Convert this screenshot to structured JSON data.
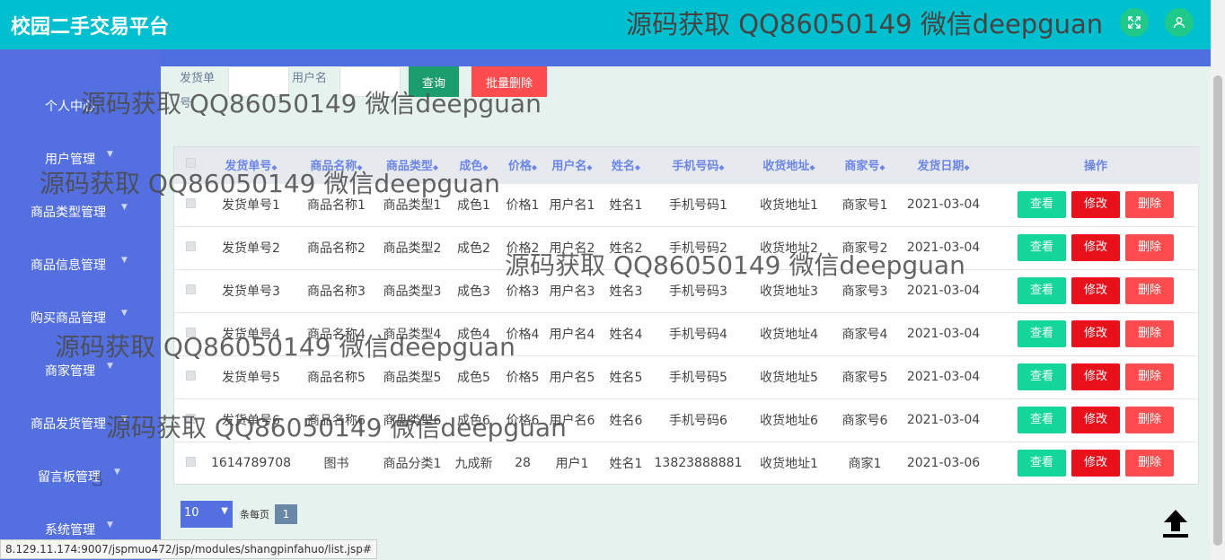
{
  "header": {
    "title": "校园二手交易平台",
    "watermark": "源码获取 QQ86050149 微信deepguan",
    "fullscreen_icon": "expand-icon",
    "user_icon": "user-icon"
  },
  "sidebar": {
    "items": [
      {
        "label": "个人中心"
      },
      {
        "label": "用户管理"
      },
      {
        "label": "商品类型管理"
      },
      {
        "label": "商品信息管理"
      },
      {
        "label": "购买商品管理"
      },
      {
        "label": "商家管理"
      },
      {
        "label": "商品发货管理"
      },
      {
        "label": "留言板管理"
      },
      {
        "label": "系统管理"
      }
    ]
  },
  "search": {
    "label1": "发货单号",
    "label2": "用户名",
    "query_label": "查询",
    "batch_delete_label": "批量删除"
  },
  "table": {
    "headers": [
      "发货单号",
      "商品名称",
      "商品类型",
      "成色",
      "价格",
      "用户名",
      "姓名",
      "手机号码",
      "收货地址",
      "商家号",
      "发货日期",
      "操作"
    ],
    "rows": [
      [
        "发货单号1",
        "商品名称1",
        "商品类型1",
        "成色1",
        "价格1",
        "用户名1",
        "姓名1",
        "手机号码1",
        "收货地址1",
        "商家号1",
        "2021-03-04"
      ],
      [
        "发货单号2",
        "商品名称2",
        "商品类型2",
        "成色2",
        "价格2",
        "用户名2",
        "姓名2",
        "手机号码2",
        "收货地址2",
        "商家号2",
        "2021-03-04"
      ],
      [
        "发货单号3",
        "商品名称3",
        "商品类型3",
        "成色3",
        "价格3",
        "用户名3",
        "姓名3",
        "手机号码3",
        "收货地址3",
        "商家号3",
        "2021-03-04"
      ],
      [
        "发货单号4",
        "商品名称4",
        "商品类型4",
        "成色4",
        "价格4",
        "用户名4",
        "姓名4",
        "手机号码4",
        "收货地址4",
        "商家号4",
        "2021-03-04"
      ],
      [
        "发货单号5",
        "商品名称5",
        "商品类型5",
        "成色5",
        "价格5",
        "用户名5",
        "姓名5",
        "手机号码5",
        "收货地址5",
        "商家号5",
        "2021-03-04"
      ],
      [
        "发货单号6",
        "商品名称6",
        "商品类型6",
        "成色6",
        "价格6",
        "用户名6",
        "姓名6",
        "手机号码6",
        "收货地址6",
        "商家号6",
        "2021-03-04"
      ],
      [
        "1614789708",
        "图书",
        "商品分类1",
        "九成新",
        "28",
        "用户1",
        "姓名1",
        "13823888881",
        "收货地址1",
        "商家1",
        "2021-03-06"
      ]
    ],
    "action_view": "查看",
    "action_edit": "修改",
    "action_delete": "删除"
  },
  "pager": {
    "page_size": "10",
    "per_page_label": "条每页",
    "current_page": "1"
  },
  "status_url": "8.129.11.174:9007/jspmuo472/jsp/modules/shangpinfahuo/list.jsp#",
  "colors": {
    "header_bg": "#00c0d0",
    "sidebar_bg": "#5470e0",
    "view_btn": "#14d69a",
    "edit_btn": "#e8101a",
    "delete_btn": "#ff4d4f"
  }
}
